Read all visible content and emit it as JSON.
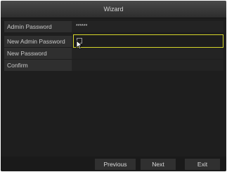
{
  "window": {
    "title": "Wizard"
  },
  "form": {
    "rows": [
      {
        "label": "Admin Password",
        "value": "******"
      },
      {
        "label": "New Admin Password",
        "value": ""
      },
      {
        "label": "New Password",
        "value": ""
      },
      {
        "label": "Confirm",
        "value": ""
      }
    ]
  },
  "footer": {
    "previous_label": "Previous",
    "next_label": "Next",
    "exit_label": "Exit"
  },
  "colors": {
    "focus_border": "#d6d62a",
    "background": "#1e1e1e"
  }
}
